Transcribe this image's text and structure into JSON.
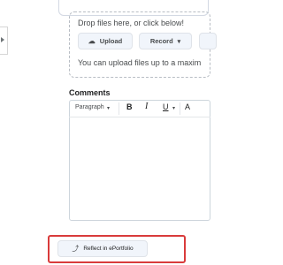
{
  "dropzone": {
    "prompt": "Drop files here, or click below!",
    "upload_label": "Upload",
    "record_label": "Record",
    "limit_text": "You can upload files up to a maxim"
  },
  "comments": {
    "label": "Comments",
    "toolbar": {
      "paragraph": "Paragraph",
      "bold": "B",
      "italic": "I",
      "underline": "U",
      "font": "A"
    }
  },
  "reflect": {
    "button_label": "Reflect in ePortfolio"
  },
  "icons": {
    "upload": "cloud-upload-icon",
    "record_chevron": "chevron-down-icon",
    "reflect": "eportfolio-reflect-icon",
    "side_handle": "caret-right-icon"
  },
  "colors": {
    "highlight_border": "#d93b3b",
    "button_bg": "#f1f5fb",
    "text": "#494c4e"
  }
}
